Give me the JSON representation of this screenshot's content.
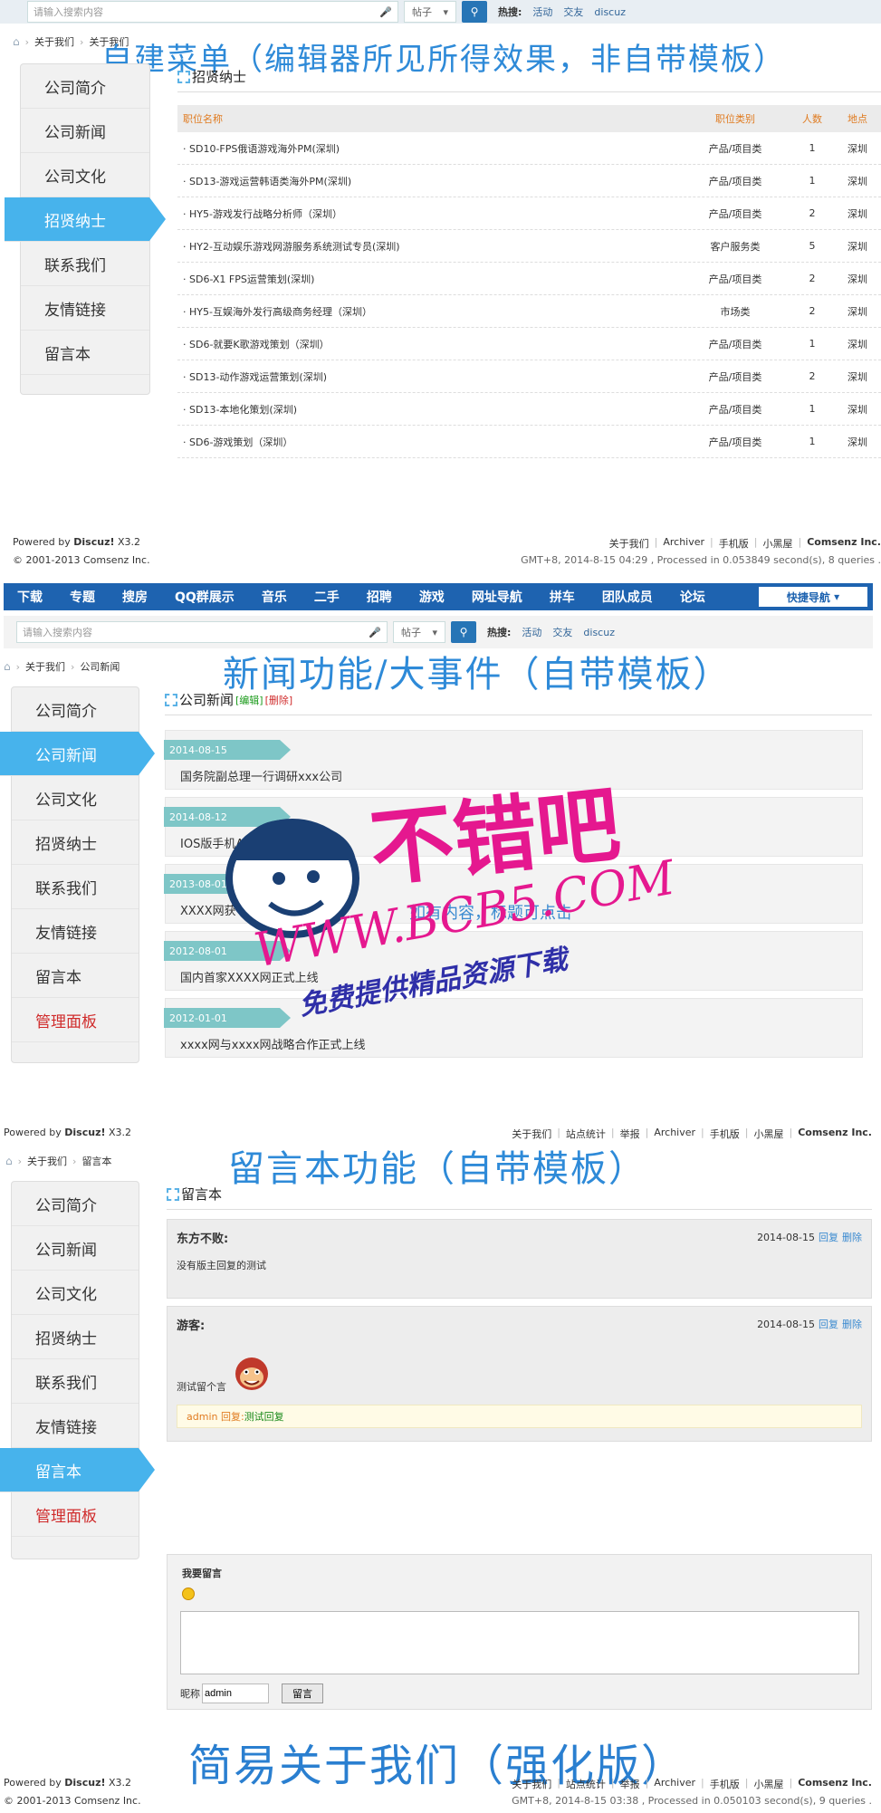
{
  "section1": {
    "search_placeholder": "请输入搜索内容",
    "search_type": "帖子",
    "hot_label": "热搜:",
    "hot_links": [
      "活动",
      "交友",
      "discuz"
    ],
    "breadcrumb": [
      "关于我们",
      "关于我们"
    ],
    "overlay": "自建菜单（编辑器所见所得效果，非自带模板）",
    "sidebar": [
      "公司简介",
      "公司新闻",
      "公司文化",
      "招贤纳士",
      "联系我们",
      "友情链接",
      "留言本"
    ],
    "page_title": "招贤纳士",
    "table_headers": [
      "职位名称",
      "职位类别",
      "人数",
      "地点"
    ],
    "jobs": [
      [
        "SD10-FPS俄语游戏海外PM(深圳)",
        "产品/项目类",
        "1",
        "深圳"
      ],
      [
        "SD13-游戏运营韩语类海外PM(深圳)",
        "产品/项目类",
        "1",
        "深圳"
      ],
      [
        "HY5-游戏发行战略分析师（深圳）",
        "产品/项目类",
        "2",
        "深圳"
      ],
      [
        "HY2-互动娱乐游戏网游服务系统测试专员(深圳)",
        "客户服务类",
        "5",
        "深圳"
      ],
      [
        "SD6-X1 FPS运营策划(深圳)",
        "产品/项目类",
        "2",
        "深圳"
      ],
      [
        "HY5-互娱海外发行高级商务经理（深圳）",
        "市场类",
        "2",
        "深圳"
      ],
      [
        "SD6-就要K歌游戏策划（深圳）",
        "产品/项目类",
        "1",
        "深圳"
      ],
      [
        "SD13-动作游戏运营策划(深圳)",
        "产品/项目类",
        "2",
        "深圳"
      ],
      [
        "SD13-本地化策划(深圳)",
        "产品/项目类",
        "1",
        "深圳"
      ],
      [
        "SD6-游戏策划（深圳）",
        "产品/项目类",
        "1",
        "深圳"
      ]
    ],
    "powered": "Powered by",
    "powered_brand": "Discuz!",
    "powered_ver": "X3.2",
    "copyright": "© 2001-2013 Comsenz Inc.",
    "footer_links": [
      "关于我们",
      "Archiver",
      "手机版",
      "小黑屋",
      "Comsenz Inc."
    ],
    "footer_meta": "GMT+8, 2014-8-15 04:29 , Processed in 0.053849 second(s), 8 queries ."
  },
  "section2": {
    "nav": [
      "下载",
      "专题",
      "搜房",
      "QQ群展示",
      "音乐",
      "二手",
      "招聘",
      "游戏",
      "网址导航",
      "拼车",
      "团队成员",
      "论坛"
    ],
    "quicknav": "快捷导航",
    "search_placeholder": "请输入搜索内容",
    "search_type": "帖子",
    "hot_label": "热搜:",
    "hot_links": [
      "活动",
      "交友",
      "discuz"
    ],
    "breadcrumb": [
      "关于我们",
      "公司新闻"
    ],
    "overlay": "新闻功能/大事件（自带模板）",
    "sidebar": [
      "公司简介",
      "公司新闻",
      "公司文化",
      "招贤纳士",
      "联系我们",
      "友情链接",
      "留言本",
      "管理面板"
    ],
    "page_title": "公司新闻",
    "edit": "[编辑]",
    "delete": "[删除]",
    "news": [
      {
        "date": "2014-08-15",
        "title": "国务院副总理一行调研xxx公司"
      },
      {
        "date": "2014-08-12",
        "title": "IOS版手机APP上线"
      },
      {
        "date": "2013-08-01",
        "title": "XXXX网获\"中国XXX贡献奖\""
      },
      {
        "date": "2012-08-01",
        "title": "国内首家XXXX网正式上线"
      },
      {
        "date": "2012-01-01",
        "title": "xxxx网与xxxx网战略合作正式上线"
      }
    ],
    "hint": "如有内容，标题可点击",
    "powered": "Powered by",
    "powered_brand": "Discuz!",
    "powered_ver": "X3.2",
    "footer_links": [
      "关于我们",
      "站点统计",
      "举报",
      "Archiver",
      "手机版",
      "小黑屋",
      "Comsenz Inc."
    ]
  },
  "section3": {
    "breadcrumb": [
      "关于我们",
      "留言本"
    ],
    "overlay": "留言本功能（自带模板）",
    "sidebar": [
      "公司简介",
      "公司新闻",
      "公司文化",
      "招贤纳士",
      "联系我们",
      "友情链接",
      "留言本",
      "管理面板"
    ],
    "page_title": "留言本",
    "messages": [
      {
        "name": "东方不败:",
        "date": "2014-08-15",
        "reply": "回复",
        "delete": "删除",
        "content": "没有版主回复的测试"
      },
      {
        "name": "游客:",
        "date": "2014-08-15",
        "reply": "回复",
        "delete": "删除",
        "content": "测试留个言",
        "admin": "admin",
        "admin_reply_label": "回复:",
        "admin_reply": "测试回复"
      }
    ],
    "form_title": "我要留言",
    "nick_label": "昵称",
    "nick_value": "admin",
    "submit": "留言",
    "overlay_bottom": "简易关于我们（强化版）",
    "powered": "Powered by",
    "powered_brand": "Discuz!",
    "powered_ver": "X3.2",
    "copyright": "© 2001-2013 Comsenz Inc.",
    "footer_links": [
      "关于我们",
      "站点统计",
      "举报",
      "Archiver",
      "手机版",
      "小黑屋",
      "Comsenz Inc."
    ],
    "footer_meta": "GMT+8, 2014-8-15 03:38 , Processed in 0.050103 second(s), 9 queries ."
  },
  "watermark": {
    "brand": "不错吧",
    "url": "WWW.BCB5.COM",
    "tagline": "免费提供精品资源下载"
  }
}
